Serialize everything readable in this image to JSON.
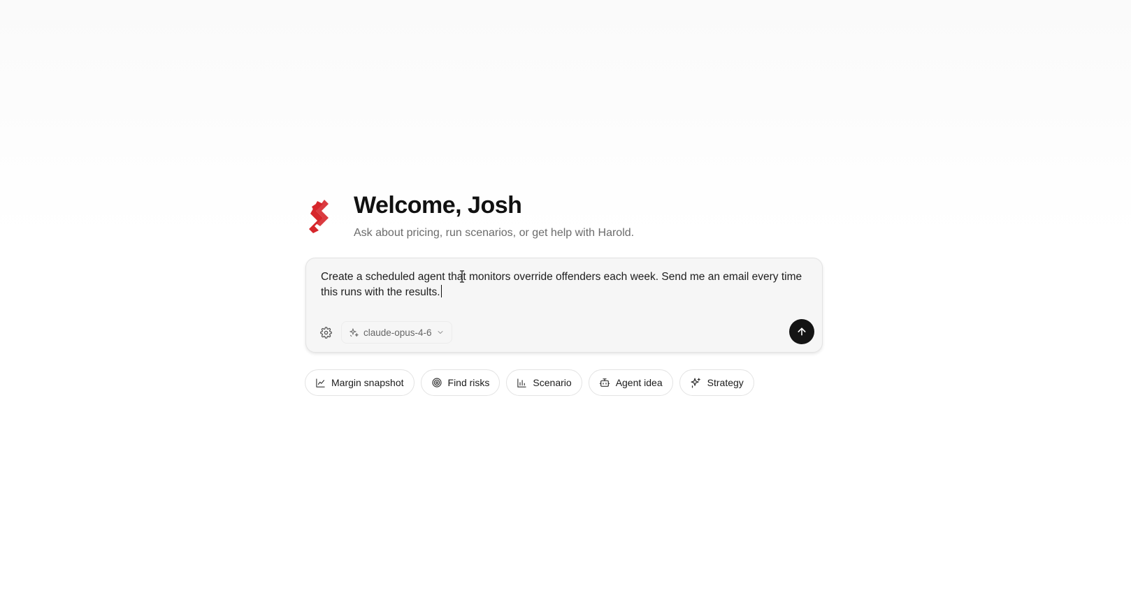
{
  "hero": {
    "title": "Welcome, Josh",
    "subtitle": "Ask about pricing, run scenarios, or get help with Harold."
  },
  "composer": {
    "text": "Create a scheduled agent that monitors override offenders each week. Send me an email every time this runs with the results.",
    "model": "claude-opus-4-6"
  },
  "chips": [
    {
      "label": "Margin snapshot",
      "icon": "line-chart-icon"
    },
    {
      "label": "Find risks",
      "icon": "target-icon"
    },
    {
      "label": "Scenario",
      "icon": "bar-chart-icon"
    },
    {
      "label": "Agent idea",
      "icon": "bot-icon"
    },
    {
      "label": "Strategy",
      "icon": "sparkles-icon"
    }
  ],
  "colors": {
    "brand": "#d6262b",
    "send_button": "#141414"
  }
}
